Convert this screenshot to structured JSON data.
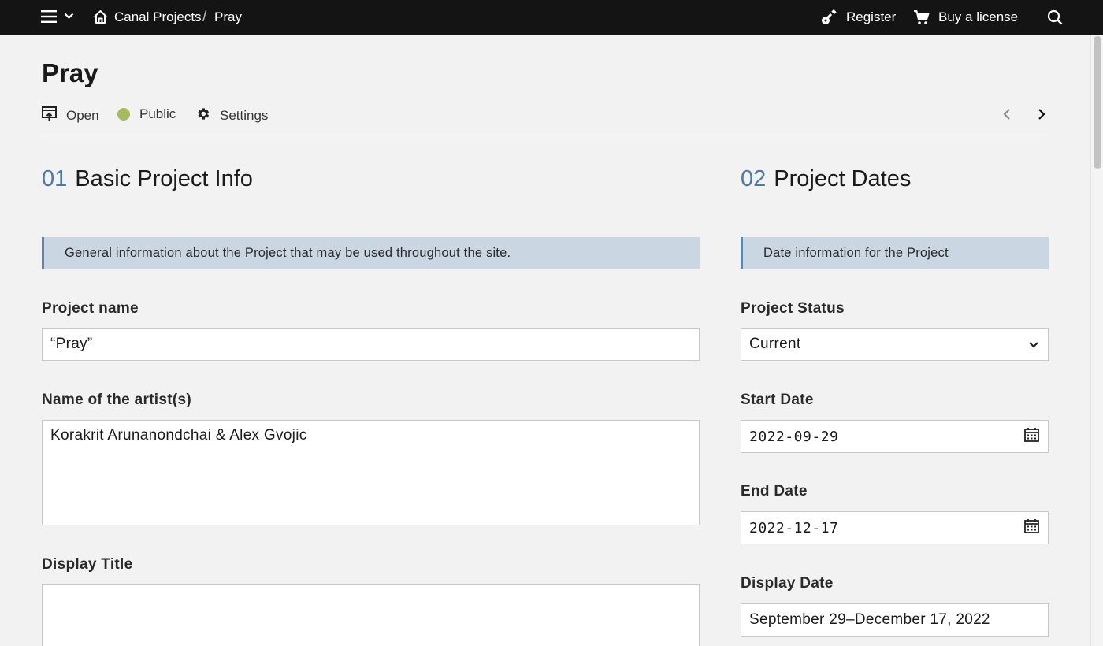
{
  "nav": {
    "menu_icon": "hamburger-menu-icon",
    "dropdown_icon": "chevron-down-icon",
    "home_icon": "home-icon",
    "breadcrumb_root": "Canal Projects",
    "breadcrumb_separator": "/",
    "breadcrumb_current": "Pray",
    "register_label": "Register",
    "buy_license_label": "Buy a license",
    "search_icon": "search-icon"
  },
  "page": {
    "title": "Pray",
    "toolbar": {
      "open_label": "Open",
      "public_label": "Public",
      "settings_label": "Settings",
      "public_dot_color": "#a7bb5c"
    }
  },
  "sections": {
    "basic": {
      "number": "01",
      "title": "Basic Project Info",
      "description": "General information about the Project that may be used throughout the site.",
      "fields": {
        "project_name_label": "Project name",
        "project_name_value": "“Pray”",
        "artists_label": "Name of the artist(s)",
        "artists_value": "Korakrit Arunanondchai & Alex Gvojic",
        "display_title_label": "Display Title",
        "display_title_value": ""
      }
    },
    "dates": {
      "number": "02",
      "title": "Project Dates",
      "description": "Date information for the Project",
      "fields": {
        "status_label": "Project Status",
        "status_value": "Current",
        "start_label": "Start Date",
        "start_value": "2022-09-29",
        "end_label": "End Date",
        "end_value": "2022-12-17",
        "display_date_label": "Display Date",
        "display_date_value": "September 29–December 17, 2022"
      }
    }
  },
  "colors": {
    "topbar": "#141414",
    "accent": "#4b79a8",
    "banner_bg": "#cad6e2"
  }
}
